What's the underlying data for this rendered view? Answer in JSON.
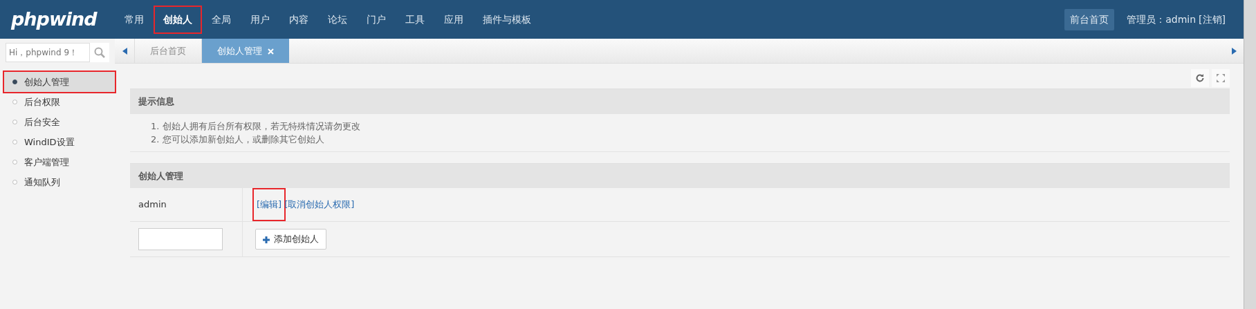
{
  "header": {
    "logo": "phpwind",
    "nav": [
      {
        "label": "常用",
        "selected": false,
        "highlighted": false
      },
      {
        "label": "创始人",
        "selected": true,
        "highlighted": true
      },
      {
        "label": "全局",
        "selected": false,
        "highlighted": false
      },
      {
        "label": "用户",
        "selected": false,
        "highlighted": false
      },
      {
        "label": "内容",
        "selected": false,
        "highlighted": false
      },
      {
        "label": "论坛",
        "selected": false,
        "highlighted": false
      },
      {
        "label": "门户",
        "selected": false,
        "highlighted": false
      },
      {
        "label": "工具",
        "selected": false,
        "highlighted": false
      },
      {
        "label": "应用",
        "selected": false,
        "highlighted": false
      },
      {
        "label": "插件与模板",
        "selected": false,
        "highlighted": false
      }
    ],
    "front_link": "前台首页",
    "admin_label": "管理员：admin",
    "logout": "[注销]"
  },
  "search": {
    "placeholder": "Hi，phpwind 9！"
  },
  "sidebar": {
    "items": [
      {
        "label": "创始人管理",
        "selected": true,
        "highlighted": true
      },
      {
        "label": "后台权限",
        "selected": false,
        "highlighted": false
      },
      {
        "label": "后台安全",
        "selected": false,
        "highlighted": false
      },
      {
        "label": "WindID设置",
        "selected": false,
        "highlighted": false
      },
      {
        "label": "客户端管理",
        "selected": false,
        "highlighted": false
      },
      {
        "label": "通知队列",
        "selected": false,
        "highlighted": false
      }
    ]
  },
  "tabs": [
    {
      "label": "后台首页",
      "selected": false,
      "closable": false
    },
    {
      "label": "创始人管理",
      "selected": true,
      "closable": true
    }
  ],
  "tips": {
    "title": "提示信息",
    "lines": [
      "1. 创始人拥有后台所有权限，若无特殊情况请勿更改",
      "2. 您可以添加新创始人，或删除其它创始人"
    ]
  },
  "founders": {
    "title": "创始人管理",
    "rows": [
      {
        "name": "admin",
        "actions": [
          {
            "label": "[编辑]",
            "highlighted": true
          },
          {
            "label": "[取消创始人权限]",
            "highlighted": false
          }
        ]
      }
    ],
    "add_button": "添加创始人"
  }
}
